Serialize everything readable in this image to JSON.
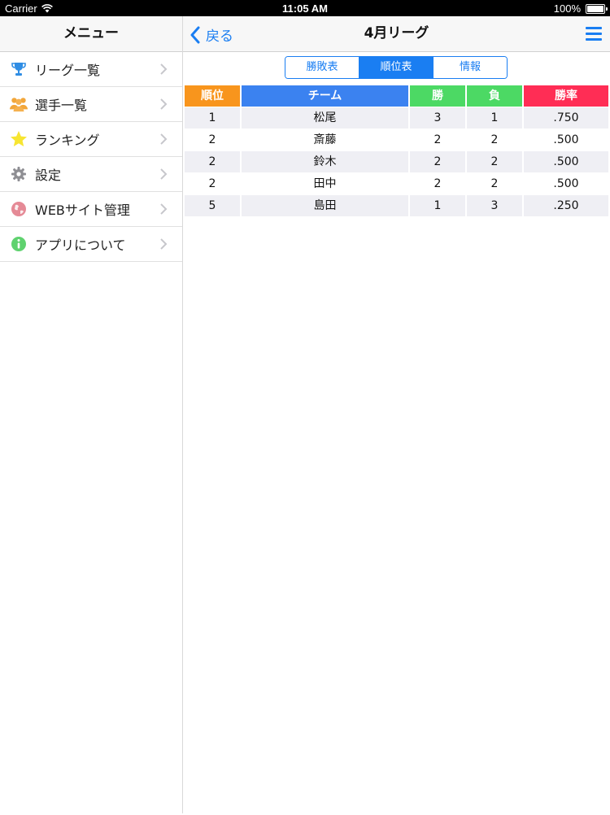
{
  "status_bar": {
    "carrier": "Carrier",
    "time": "11:05 AM",
    "battery": "100%"
  },
  "sidebar": {
    "title": "メニュー",
    "items": [
      {
        "label": "リーグ一覧",
        "icon": "trophy-icon",
        "color": "#2f8de4"
      },
      {
        "label": "選手一覧",
        "icon": "people-icon",
        "color": "#f2a63a"
      },
      {
        "label": "ランキング",
        "icon": "star-icon",
        "color": "#f7e531"
      },
      {
        "label": "設定",
        "icon": "gear-icon",
        "color": "#8e8e93"
      },
      {
        "label": "WEBサイト管理",
        "icon": "globe-icon",
        "color": "#e58a96"
      },
      {
        "label": "アプリについて",
        "icon": "info-icon",
        "color": "#5fd26f"
      }
    ]
  },
  "nav": {
    "back_label": "戻る",
    "title": "4月リーグ"
  },
  "segments": {
    "items": [
      "勝敗表",
      "順位表",
      "情報"
    ],
    "selected": "順位表"
  },
  "standings": {
    "columns": [
      "順位",
      "チーム",
      "勝",
      "負",
      "勝率"
    ],
    "column_colors": [
      "#f8951d",
      "#3b82f0",
      "#4cd964",
      "#4cd964",
      "#ff2d55"
    ],
    "rows": [
      {
        "rank": "1",
        "team": "松尾",
        "wins": "3",
        "losses": "1",
        "pct": ".750"
      },
      {
        "rank": "2",
        "team": "斎藤",
        "wins": "2",
        "losses": "2",
        "pct": ".500"
      },
      {
        "rank": "2",
        "team": "鈴木",
        "wins": "2",
        "losses": "2",
        "pct": ".500"
      },
      {
        "rank": "2",
        "team": "田中",
        "wins": "2",
        "losses": "2",
        "pct": ".500"
      },
      {
        "rank": "5",
        "team": "島田",
        "wins": "1",
        "losses": "3",
        "pct": ".250"
      }
    ]
  },
  "colors": {
    "accent": "#1a7ef2"
  }
}
